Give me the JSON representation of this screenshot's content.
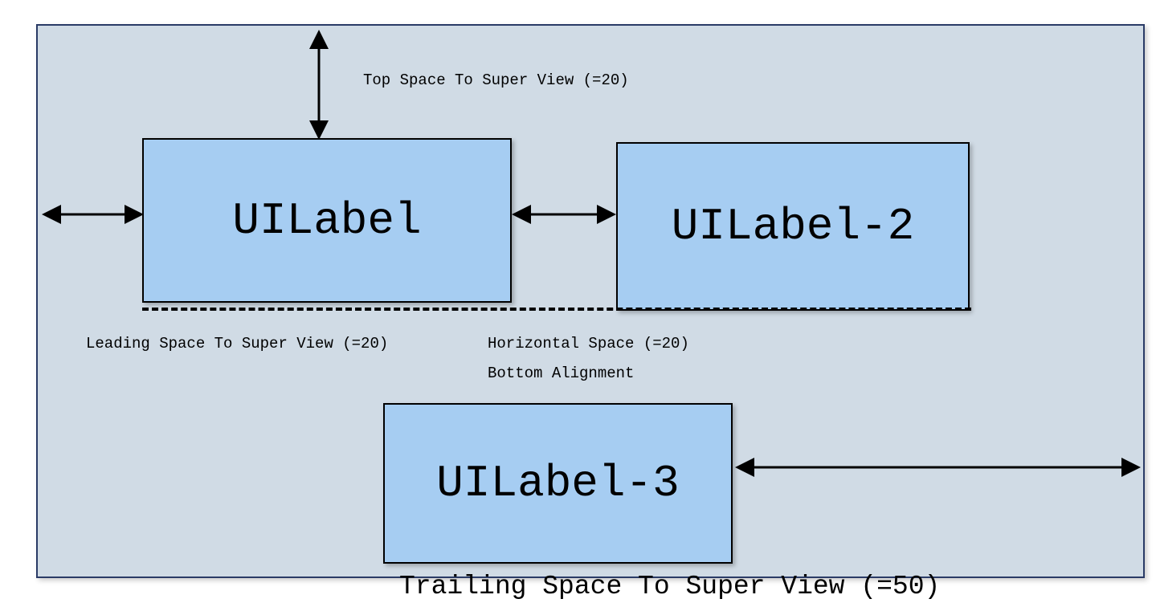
{
  "labels": {
    "label1": "UILabel",
    "label2": "UILabel-2",
    "label3": "UILabel-3"
  },
  "captions": {
    "top": "Top Space To Super View (=20)",
    "leading": "Leading Space To Super View (=20)",
    "hspace": "Horizontal Space (=20)",
    "balign": "Bottom Alignment",
    "trailing": "Trailing Space To Super View (=50)"
  }
}
